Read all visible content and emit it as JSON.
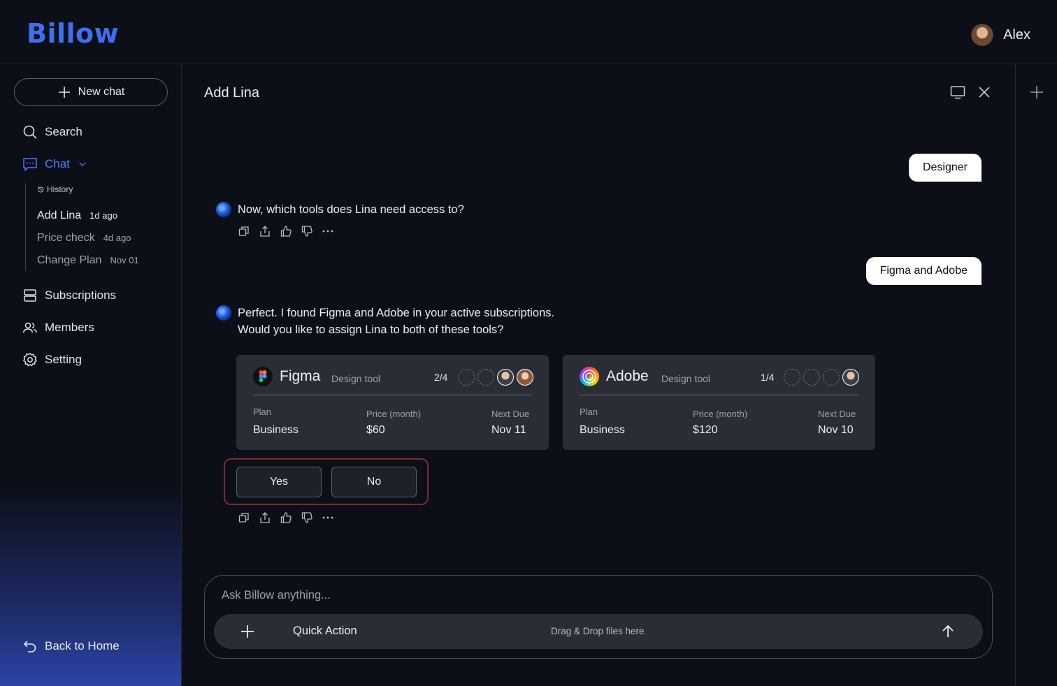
{
  "app": {
    "logo": "Billow",
    "user_name": "Alex"
  },
  "sidebar": {
    "new_chat_label": "New chat",
    "search_label": "Search",
    "chat_label": "Chat",
    "history_label": "History",
    "history": [
      {
        "title": "Add Lina",
        "time": "1d ago"
      },
      {
        "title": "Price check",
        "time": "4d ago"
      },
      {
        "title": "Change Plan",
        "time": "Nov 01"
      }
    ],
    "subscriptions_label": "Subscriptions",
    "members_label": "Members",
    "setting_label": "Setting",
    "back_home_label": "Back to Home"
  },
  "conversation": {
    "title": "Add Lina",
    "user_msg_1": "Designer",
    "bot_msg_1": "Now, which tools does Lina need access to?",
    "user_msg_2": "Figma and Adobe",
    "bot_msg_2_line1": "Perfect. I found Figma and Adobe in your active subscriptions.",
    "bot_msg_2_line2": "Would you like to assign Lina to both of these tools?",
    "cards": [
      {
        "name": "Figma",
        "type": "Design tool",
        "seats_used": "2/4",
        "plan_label": "Plan",
        "plan": "Business",
        "price_label": "Price (month)",
        "price": "$60",
        "due_label": "Next Due",
        "due": "Nov 11"
      },
      {
        "name": "Adobe",
        "type": "Design tool",
        "seats_used": "1/4",
        "plan_label": "Plan",
        "plan": "Business",
        "price_label": "Price (month)",
        "price": "$120",
        "due_label": "Next Due",
        "due": "Nov 10"
      }
    ],
    "yes_label": "Yes",
    "no_label": "No"
  },
  "composer": {
    "placeholder": "Ask Billow anything...",
    "quick_action_label": "Quick Action",
    "drag_drop_label": "Drag & Drop files here"
  },
  "colors": {
    "accent": "#3f6ff0",
    "background": "#0c0f17",
    "card": "#2a2d35",
    "highlight_border": "#7a2a30"
  }
}
